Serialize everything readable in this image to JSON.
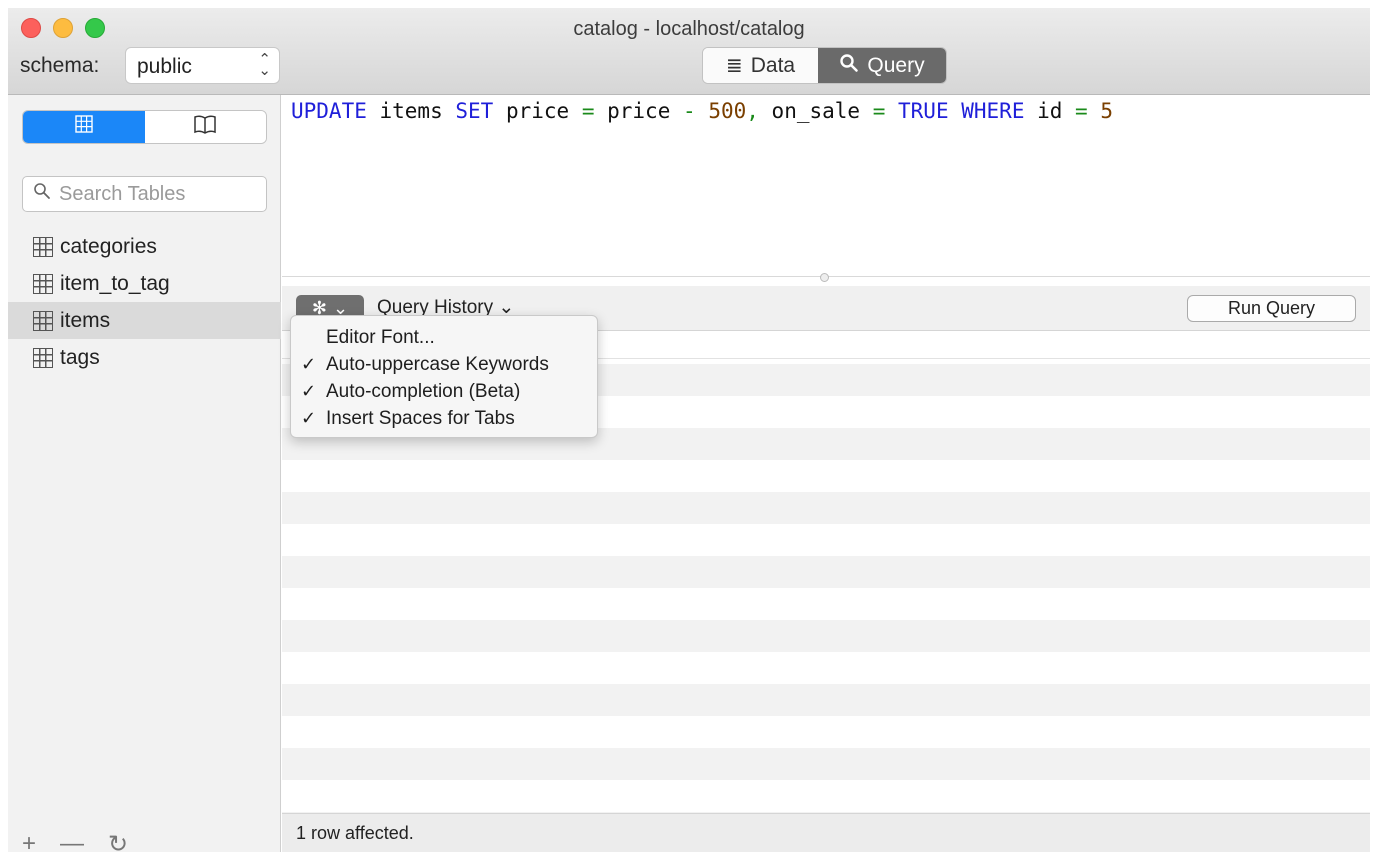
{
  "window": {
    "title": "catalog - localhost/catalog"
  },
  "toolbar": {
    "schema_label": "schema:",
    "schema_value": "public",
    "view_tabs": [
      {
        "label": "Data",
        "icon": "list-icon",
        "selected": false
      },
      {
        "label": "Query",
        "icon": "search-icon",
        "selected": true
      }
    ]
  },
  "sidebar": {
    "mode_tabs": [
      {
        "icon": "table-grid-icon",
        "selected": true
      },
      {
        "icon": "book-icon",
        "selected": false
      }
    ],
    "search_placeholder": "Search Tables",
    "tables": [
      {
        "name": "categories",
        "selected": false
      },
      {
        "name": "item_to_tag",
        "selected": false
      },
      {
        "name": "items",
        "selected": true
      },
      {
        "name": "tags",
        "selected": false
      }
    ],
    "bottom_buttons": [
      "add-icon",
      "remove-icon",
      "refresh-icon"
    ]
  },
  "editor": {
    "query_tokens": [
      {
        "t": "UPDATE",
        "k": "kw"
      },
      {
        "t": " items ",
        "k": ""
      },
      {
        "t": "SET",
        "k": "kw"
      },
      {
        "t": " price ",
        "k": ""
      },
      {
        "t": "=",
        "k": "op"
      },
      {
        "t": " price ",
        "k": ""
      },
      {
        "t": "-",
        "k": "op"
      },
      {
        "t": " ",
        "k": ""
      },
      {
        "t": "500",
        "k": "num"
      },
      {
        "t": ",",
        "k": "op"
      },
      {
        "t": " on_sale ",
        "k": ""
      },
      {
        "t": "=",
        "k": "op"
      },
      {
        "t": " ",
        "k": ""
      },
      {
        "t": "TRUE",
        "k": "kw"
      },
      {
        "t": " ",
        "k": ""
      },
      {
        "t": "WHERE",
        "k": "kw"
      },
      {
        "t": " id ",
        "k": ""
      },
      {
        "t": "=",
        "k": "op"
      },
      {
        "t": " ",
        "k": ""
      },
      {
        "t": "5",
        "k": "num"
      }
    ]
  },
  "query_toolbar": {
    "history_label": "Query History",
    "run_label": "Run Query"
  },
  "gear_menu": {
    "items": [
      {
        "label": "Editor Font...",
        "checked": false
      },
      {
        "label": "Auto-uppercase Keywords",
        "checked": true
      },
      {
        "label": "Auto-completion (Beta)",
        "checked": true
      },
      {
        "label": "Insert Spaces for Tabs",
        "checked": true
      }
    ],
    "check_glyph": "✓"
  },
  "status": {
    "message": "1 row affected."
  },
  "colors": {
    "accent": "#1b87f8",
    "keyword": "#1f1fd9",
    "operator": "#1a8a1a",
    "number": "#7a3f00"
  }
}
